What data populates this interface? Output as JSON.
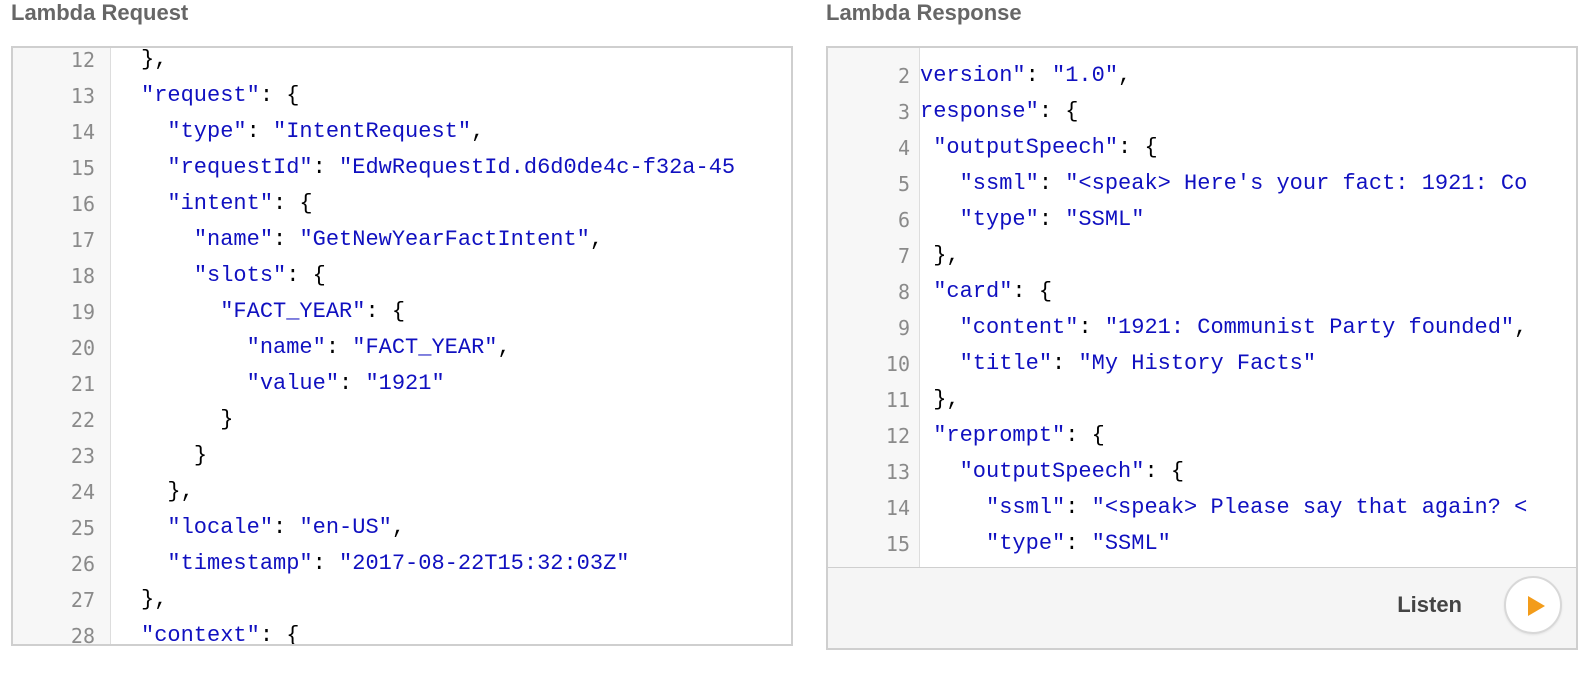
{
  "request_panel": {
    "title": "Lambda Request",
    "lines": [
      {
        "n": "12",
        "ind": "",
        "toks": [
          [
            "p",
            "},"
          ]
        ]
      },
      {
        "n": "13",
        "ind": "",
        "toks": [
          [
            "k",
            "\"request\""
          ],
          [
            "p",
            ": {"
          ]
        ]
      },
      {
        "n": "14",
        "ind": "  ",
        "toks": [
          [
            "k",
            "\"type\""
          ],
          [
            "p",
            ": "
          ],
          [
            "s",
            "\"IntentRequest\""
          ],
          [
            "p",
            ","
          ]
        ]
      },
      {
        "n": "15",
        "ind": "  ",
        "toks": [
          [
            "k",
            "\"requestId\""
          ],
          [
            "p",
            ": "
          ],
          [
            "s",
            "\"EdwRequestId.d6d0de4c-f32a-45"
          ]
        ]
      },
      {
        "n": "16",
        "ind": "  ",
        "toks": [
          [
            "k",
            "\"intent\""
          ],
          [
            "p",
            ": {"
          ]
        ]
      },
      {
        "n": "17",
        "ind": "    ",
        "toks": [
          [
            "k",
            "\"name\""
          ],
          [
            "p",
            ": "
          ],
          [
            "s",
            "\"GetNewYearFactIntent\""
          ],
          [
            "p",
            ","
          ]
        ]
      },
      {
        "n": "18",
        "ind": "    ",
        "toks": [
          [
            "k",
            "\"slots\""
          ],
          [
            "p",
            ": {"
          ]
        ]
      },
      {
        "n": "19",
        "ind": "      ",
        "toks": [
          [
            "k",
            "\"FACT_YEAR\""
          ],
          [
            "p",
            ": {"
          ]
        ]
      },
      {
        "n": "20",
        "ind": "        ",
        "toks": [
          [
            "k",
            "\"name\""
          ],
          [
            "p",
            ": "
          ],
          [
            "s",
            "\"FACT_YEAR\""
          ],
          [
            "p",
            ","
          ]
        ]
      },
      {
        "n": "21",
        "ind": "        ",
        "toks": [
          [
            "k",
            "\"value\""
          ],
          [
            "p",
            ": "
          ],
          [
            "s",
            "\"1921\""
          ]
        ]
      },
      {
        "n": "22",
        "ind": "      ",
        "toks": [
          [
            "p",
            "}"
          ]
        ]
      },
      {
        "n": "23",
        "ind": "    ",
        "toks": [
          [
            "p",
            "}"
          ]
        ]
      },
      {
        "n": "24",
        "ind": "  ",
        "toks": [
          [
            "p",
            "},"
          ]
        ]
      },
      {
        "n": "25",
        "ind": "  ",
        "toks": [
          [
            "k",
            "\"locale\""
          ],
          [
            "p",
            ": "
          ],
          [
            "s",
            "\"en-US\""
          ],
          [
            "p",
            ","
          ]
        ]
      },
      {
        "n": "26",
        "ind": "  ",
        "toks": [
          [
            "k",
            "\"timestamp\""
          ],
          [
            "p",
            ": "
          ],
          [
            "s",
            "\"2017-08-22T15:32:03Z\""
          ]
        ]
      },
      {
        "n": "27",
        "ind": "",
        "toks": [
          [
            "p",
            "},"
          ]
        ]
      },
      {
        "n": "28",
        "ind": "",
        "toks": [
          [
            "k",
            "\"context\""
          ],
          [
            "p",
            ": {"
          ]
        ]
      }
    ]
  },
  "response_panel": {
    "title": "Lambda Response",
    "lines": [
      {
        "n": "2",
        "ind": "",
        "toks": [
          [
            "k",
            "version\""
          ],
          [
            "p",
            ": "
          ],
          [
            "s",
            "\"1.0\""
          ],
          [
            "p",
            ","
          ]
        ]
      },
      {
        "n": "3",
        "ind": "",
        "toks": [
          [
            "k",
            "response\""
          ],
          [
            "p",
            ": {"
          ]
        ]
      },
      {
        "n": "4",
        "ind": " ",
        "toks": [
          [
            "k",
            "\"outputSpeech\""
          ],
          [
            "p",
            ": {"
          ]
        ]
      },
      {
        "n": "5",
        "ind": "   ",
        "toks": [
          [
            "k",
            "\"ssml\""
          ],
          [
            "p",
            ": "
          ],
          [
            "s",
            "\"<speak> Here's your fact: 1921: Co"
          ]
        ]
      },
      {
        "n": "6",
        "ind": "   ",
        "toks": [
          [
            "k",
            "\"type\""
          ],
          [
            "p",
            ": "
          ],
          [
            "s",
            "\"SSML\""
          ]
        ]
      },
      {
        "n": "7",
        "ind": " ",
        "toks": [
          [
            "p",
            "},"
          ]
        ]
      },
      {
        "n": "8",
        "ind": " ",
        "toks": [
          [
            "k",
            "\"card\""
          ],
          [
            "p",
            ": {"
          ]
        ]
      },
      {
        "n": "9",
        "ind": "   ",
        "toks": [
          [
            "k",
            "\"content\""
          ],
          [
            "p",
            ": "
          ],
          [
            "s",
            "\"1921: Communist Party founded\""
          ],
          [
            "p",
            ","
          ]
        ]
      },
      {
        "n": "10",
        "ind": "   ",
        "toks": [
          [
            "k",
            "\"title\""
          ],
          [
            "p",
            ": "
          ],
          [
            "s",
            "\"My History Facts\""
          ]
        ]
      },
      {
        "n": "11",
        "ind": " ",
        "toks": [
          [
            "p",
            "},"
          ]
        ]
      },
      {
        "n": "12",
        "ind": " ",
        "toks": [
          [
            "k",
            "\"reprompt\""
          ],
          [
            "p",
            ": {"
          ]
        ]
      },
      {
        "n": "13",
        "ind": "   ",
        "toks": [
          [
            "k",
            "\"outputSpeech\""
          ],
          [
            "p",
            ": {"
          ]
        ]
      },
      {
        "n": "14",
        "ind": "     ",
        "toks": [
          [
            "k",
            "\"ssml\""
          ],
          [
            "p",
            ": "
          ],
          [
            "s",
            "\"<speak> Please say that again? <"
          ]
        ]
      },
      {
        "n": "15",
        "ind": "     ",
        "toks": [
          [
            "k",
            "\"type\""
          ],
          [
            "p",
            ": "
          ],
          [
            "s",
            "\"SSML\""
          ]
        ]
      }
    ],
    "listen": {
      "label": "Listen",
      "icon": "play-icon"
    }
  },
  "colors": {
    "json_token": "#1010c0",
    "punctuation": "#000000",
    "line_number": "#8a8a8a",
    "play_accent": "#f39c1a"
  }
}
